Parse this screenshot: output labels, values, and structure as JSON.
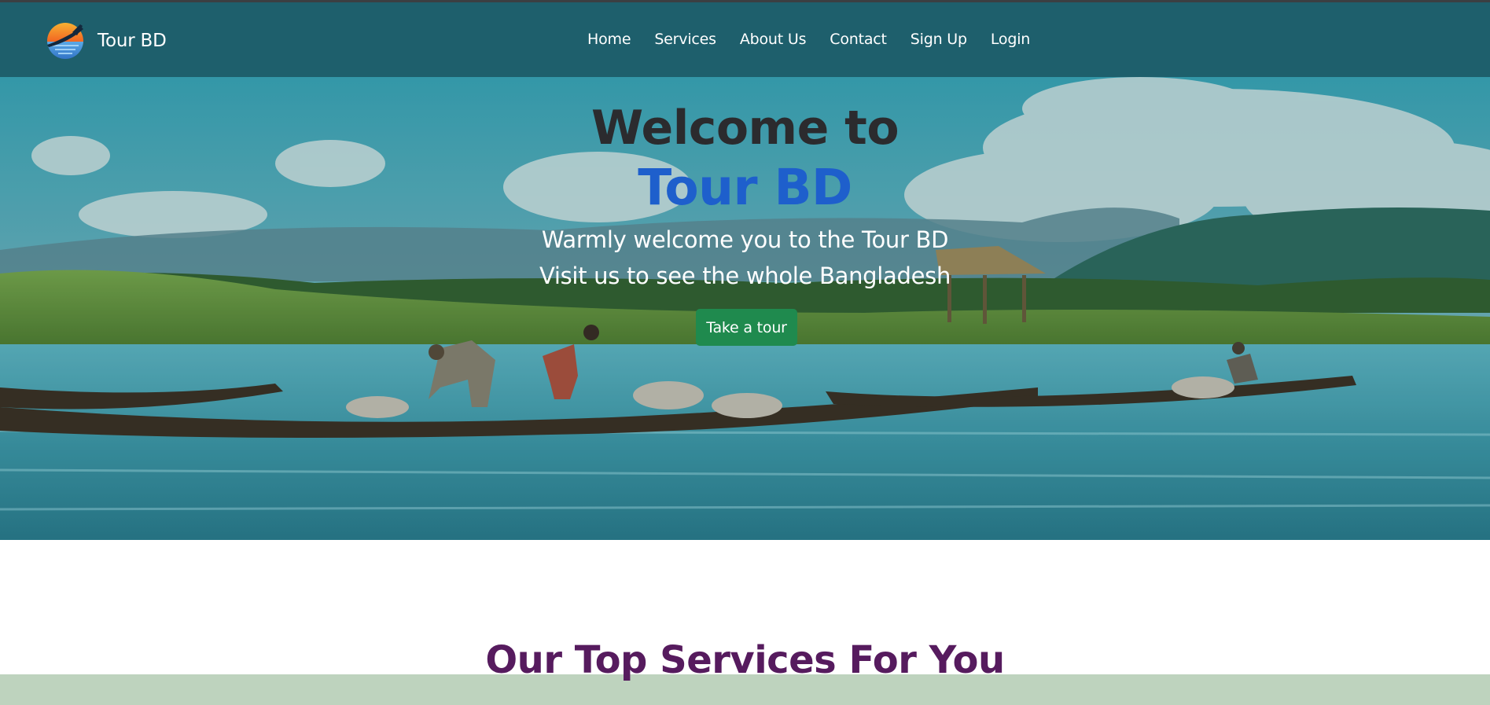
{
  "brand": {
    "name": "Tour BD",
    "logo_icon": "sunset-plane-logo"
  },
  "nav": {
    "items": [
      {
        "label": "Home"
      },
      {
        "label": "Services"
      },
      {
        "label": "About Us"
      },
      {
        "label": "Contact"
      },
      {
        "label": "Sign Up"
      },
      {
        "label": "Login"
      }
    ]
  },
  "hero": {
    "title_line1": "Welcome to",
    "title_line2": "Tour BD",
    "subtitle_line1": "Warmly welcome you to the Tour BD",
    "subtitle_line2": "Visit us to see the whole Bangladesh",
    "cta_label": "Take a tour",
    "background_image": "river-boats-landscape"
  },
  "services": {
    "title": "Our Top Services For You"
  },
  "colors": {
    "navbar": "#1e5f6c",
    "title_dark": "#2b2b2e",
    "title_accent": "#1e5fcc",
    "cta": "#1f8a4e",
    "services_title": "#561b5e",
    "band": "#bed3be"
  }
}
